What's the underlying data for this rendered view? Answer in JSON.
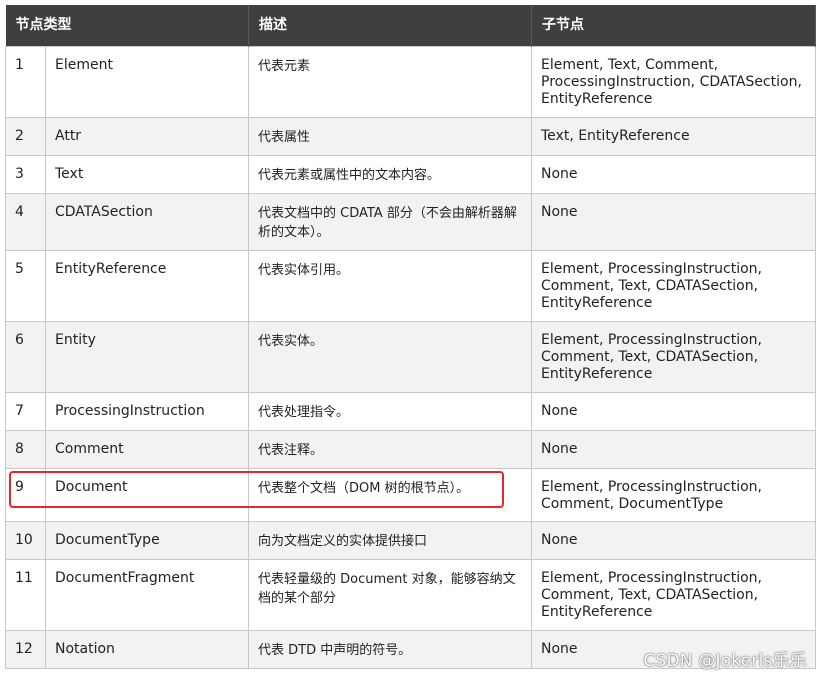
{
  "table": {
    "headers": {
      "node_type": "节点类型",
      "description": "描述",
      "children": "子节点"
    },
    "rows": [
      {
        "num": "1",
        "name": "Element",
        "desc": "代表元素",
        "children": "Element, Text, Comment, ProcessingInstruction, CDATASection, EntityReference"
      },
      {
        "num": "2",
        "name": "Attr",
        "desc": "代表属性",
        "children": "Text, EntityReference"
      },
      {
        "num": "3",
        "name": "Text",
        "desc": "代表元素或属性中的文本内容。",
        "children": "None"
      },
      {
        "num": "4",
        "name": "CDATASection",
        "desc": "代表文档中的 CDATA 部分（不会由解析器解析的文本）。",
        "children": "None"
      },
      {
        "num": "5",
        "name": "EntityReference",
        "desc": "代表实体引用。",
        "children": "Element, ProcessingInstruction, Comment, Text, CDATASection, EntityReference"
      },
      {
        "num": "6",
        "name": "Entity",
        "desc": "代表实体。",
        "children": "Element, ProcessingInstruction, Comment, Text, CDATASection, EntityReference"
      },
      {
        "num": "7",
        "name": "ProcessingInstruction",
        "desc": "代表处理指令。",
        "children": "None"
      },
      {
        "num": "8",
        "name": "Comment",
        "desc": "代表注释。",
        "children": "None"
      },
      {
        "num": "9",
        "name": "Document",
        "desc": "代表整个文档（DOM 树的根节点）。",
        "children": "Element, ProcessingInstruction, Comment, DocumentType"
      },
      {
        "num": "10",
        "name": "DocumentType",
        "desc": "向为文档定义的实体提供接口",
        "children": "None"
      },
      {
        "num": "11",
        "name": "DocumentFragment",
        "desc": "代表轻量级的 Document 对象，能够容纳文档的某个部分",
        "children": "Element, ProcessingInstruction, Comment, Text, CDATASection, EntityReference"
      },
      {
        "num": "12",
        "name": "Notation",
        "desc": "代表 DTD 中声明的符号。",
        "children": "None"
      }
    ]
  },
  "highlight": {
    "row": "9",
    "color": "#e8252b"
  },
  "watermark": "CSDN @Jokerls乐乐"
}
